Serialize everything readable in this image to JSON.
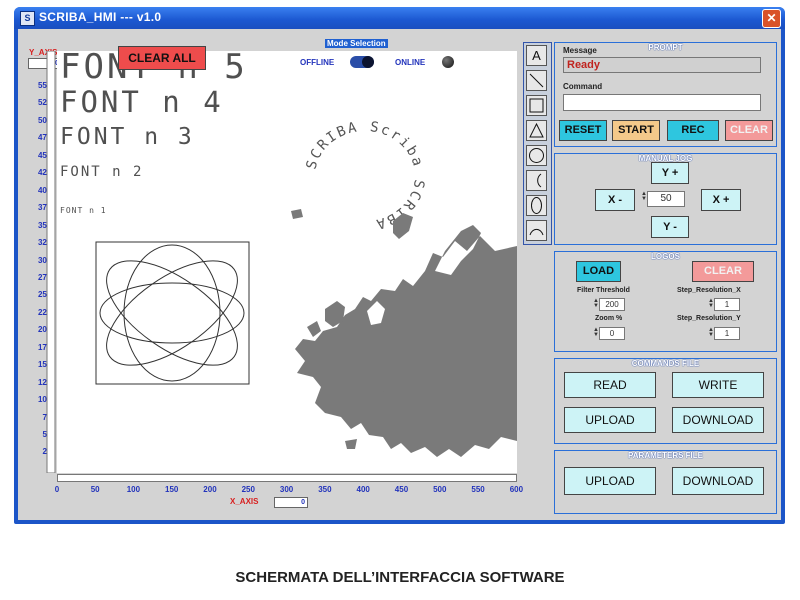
{
  "window": {
    "title": "SCRIBA_HMI --- v1.0",
    "icon": "S",
    "close_glyph": "✕"
  },
  "plot": {
    "y_axis_label": "Y_AXIS",
    "y_readout": "0",
    "x_axis_label": "X_AXIS",
    "x_readout": "0",
    "y_ticks": [
      "550",
      "525",
      "500",
      "475",
      "450",
      "425",
      "400",
      "375",
      "350",
      "325",
      "300",
      "275",
      "250",
      "225",
      "200",
      "175",
      "150",
      "125",
      "100",
      "75",
      "50",
      "25",
      "0"
    ],
    "x_ticks": [
      "0",
      "50",
      "100",
      "150",
      "200",
      "250",
      "300",
      "350",
      "400",
      "450",
      "500",
      "550",
      "600"
    ],
    "font_samples": [
      "FONT n 5",
      "FONT n 4",
      "FONT n 3",
      "FONT n 2",
      "FONT n 1"
    ],
    "circle_text": "SCRIBA Scriba SCRIBA"
  },
  "clear_all_label": "CLEAR ALL",
  "mode": {
    "title": "Mode Selection",
    "offline_label": "OFFLINE",
    "online_label": "ONLINE"
  },
  "tools": [
    {
      "icon": "text-tool-icon",
      "glyph": "A"
    },
    {
      "icon": "line-tool-icon",
      "glyph": ""
    },
    {
      "icon": "rectangle-tool-icon",
      "glyph": ""
    },
    {
      "icon": "triangle-tool-icon",
      "glyph": ""
    },
    {
      "icon": "circle-tool-icon",
      "glyph": ""
    },
    {
      "icon": "arc-tool-icon",
      "glyph": ""
    },
    {
      "icon": "ellipse-tool-icon",
      "glyph": ""
    },
    {
      "icon": "bottom-arc-tool-icon",
      "glyph": ""
    }
  ],
  "prompt": {
    "title": "PROMPT",
    "message_label": "Message",
    "message_value": "Ready",
    "command_label": "Command",
    "command_value": "",
    "reset_label": "RESET",
    "start_label": "START",
    "rec_label": "REC",
    "clear_label": "CLEAR"
  },
  "jog": {
    "title": "MANUAL JOG",
    "y_plus": "Y +",
    "y_minus": "Y -",
    "x_minus": "X -",
    "x_plus": "X +",
    "step": "50"
  },
  "logos": {
    "title": "LOGOS",
    "load_label": "LOAD",
    "clear_label": "CLEAR",
    "filter_label": "Filter Threshold",
    "filter_value": "200",
    "zoom_label": "Zoom %",
    "zoom_value": "0",
    "step_x_label": "Step_Resolution_X",
    "step_x_value": "1",
    "step_y_label": "Step_Resolution_Y",
    "step_y_value": "1"
  },
  "commands_file": {
    "title": "COMMANDS FILE",
    "read": "READ",
    "write": "WRITE",
    "upload": "UPLOAD",
    "download": "DOWNLOAD"
  },
  "parameters_file": {
    "title": "PARAMETERS FILE",
    "upload": "UPLOAD",
    "download": "DOWNLOAD"
  },
  "colors": {
    "window_blue": "#1c55c8",
    "panel_gray": "#d3d3d3",
    "axis_blue": "#2233bb",
    "alert_red": "#ee4c4c",
    "button_cyan": "#2ec6df"
  },
  "caption": "SCHERMATA DELL’INTERFACCIA SOFTWARE"
}
